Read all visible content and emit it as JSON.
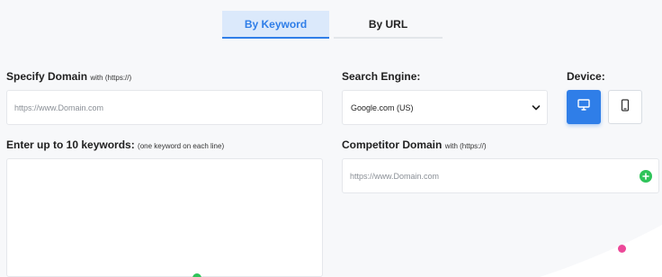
{
  "tabs": [
    {
      "label": "By Keyword",
      "active": true
    },
    {
      "label": "By URL",
      "active": false
    }
  ],
  "domain": {
    "label": "Specify Domain",
    "hint": "with (https://)",
    "placeholder": "https://www.Domain.com"
  },
  "search_engine": {
    "label": "Search Engine:",
    "selected": "Google.com (US)"
  },
  "device": {
    "label": "Device:",
    "options": [
      {
        "name": "desktop",
        "icon": "desktop-monitor-icon",
        "active": true
      },
      {
        "name": "mobile",
        "icon": "mobile-phone-icon",
        "active": false
      }
    ]
  },
  "keywords": {
    "label": "Enter up to 10 keywords:",
    "hint": "(one keyword on each line)",
    "value": ""
  },
  "competitor": {
    "label": "Competitor Domain",
    "hint": "with (https://)",
    "placeholder": "https://www.Domain.com"
  },
  "colors": {
    "accent": "#2f7ee8",
    "tab_active_bg": "#dbe9fb",
    "add_green": "#2fc45a",
    "deco_pink": "#ec4899"
  }
}
